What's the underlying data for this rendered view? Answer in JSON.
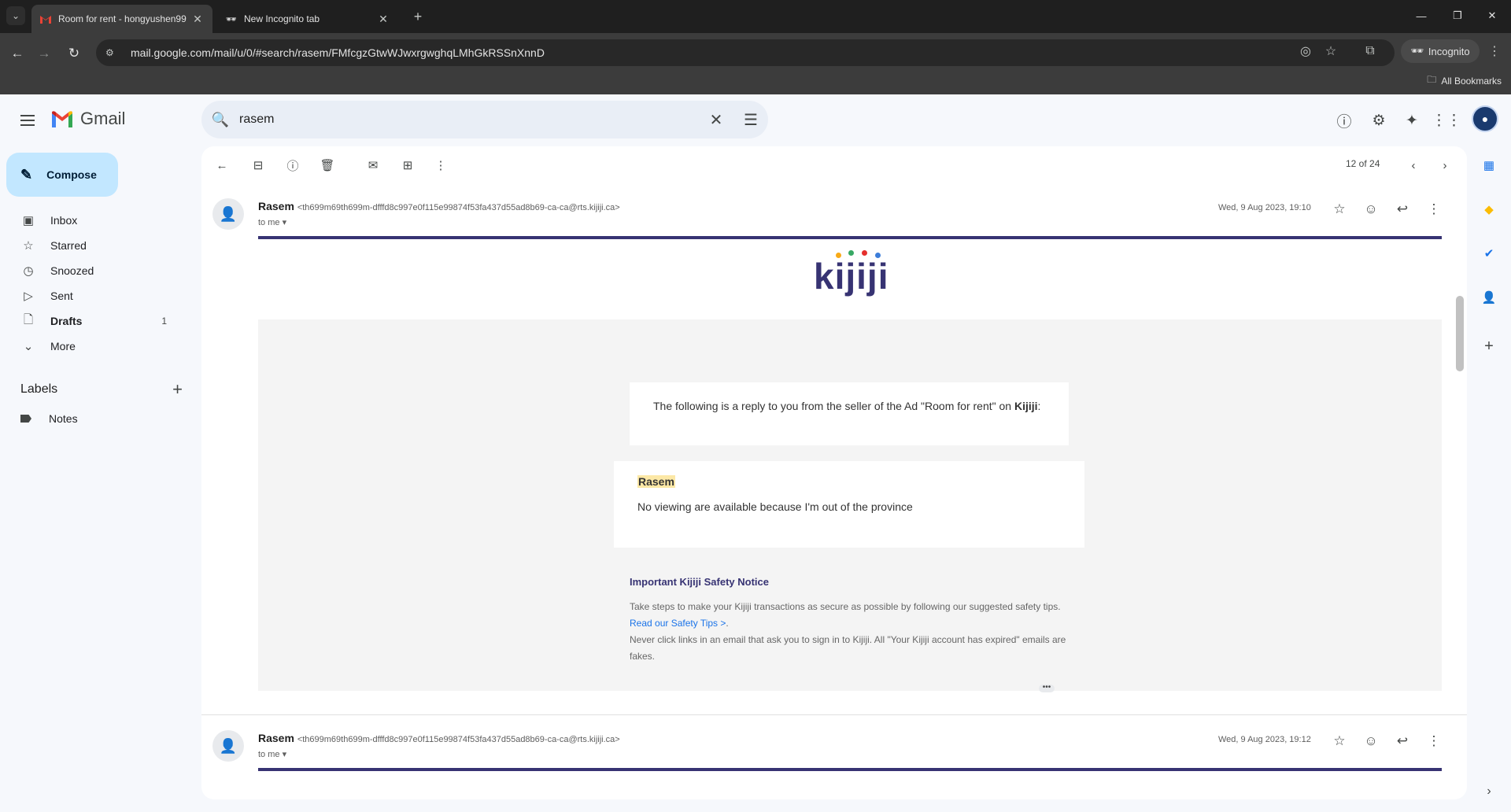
{
  "browser": {
    "tabs": [
      {
        "title": "Room for rent - hongyushen99",
        "active": true
      },
      {
        "title": "New Incognito tab",
        "active": false
      }
    ],
    "url": "mail.google.com/mail/u/0/#search/rasem/FMfcgzGtwWJwxrgwghqLMhGkRSSnXnnD",
    "incognito_label": "Incognito",
    "bookmarks_label": "All Bookmarks"
  },
  "gmail": {
    "brand": "Gmail",
    "search_value": "rasem",
    "compose_label": "Compose",
    "nav": [
      {
        "label": "Inbox",
        "count": "",
        "icon": "inbox-icon"
      },
      {
        "label": "Starred",
        "count": "",
        "icon": "star-icon"
      },
      {
        "label": "Snoozed",
        "count": "",
        "icon": "clock-icon"
      },
      {
        "label": "Sent",
        "count": "",
        "icon": "send-icon"
      },
      {
        "label": "Drafts",
        "count": "1",
        "icon": "draft-icon"
      },
      {
        "label": "More",
        "count": "",
        "icon": "chevron-down-icon"
      }
    ],
    "labels_title": "Labels",
    "labels": [
      {
        "label": "Notes"
      }
    ],
    "pager": "12 of 24"
  },
  "messages": [
    {
      "sender": "Rasem",
      "address": "<th699m69th699m-dfffd8c997e0f115e99874f53fa437d55ad8b69-ca-ca@rts.kijiji.ca>",
      "to": "to me",
      "date": "Wed, 9 Aug 2023, 19:10"
    },
    {
      "sender": "Rasem",
      "address": "<th699m69th699m-dfffd8c997e0f115e99874f53fa437d55ad8b69-ca-ca@rts.kijiji.ca>",
      "to": "to me",
      "date": "Wed, 9 Aug 2023, 19:12"
    }
  ],
  "email": {
    "logo_text": "kijiji",
    "intro": "The following is a reply to you from the seller of the Ad \"Room for rent\" on",
    "intro_brand": "Kijiji",
    "intro_end": ":",
    "reply_name": "Rasem",
    "reply_text": "No viewing are available because I'm out of the province",
    "safety_title": "Important Kijiji Safety Notice",
    "safety_p1": "Take steps to make your Kijiji transactions as secure as possible by following our suggested safety tips.",
    "safety_link": "Read our Safety Tips >",
    "safety_p1_end": ".",
    "safety_p2": "Never click links in an email that ask you to sign in to Kijiji. All \"Your Kijiji account has expired\" emails are fakes."
  },
  "colors": {
    "kijiji_purple": "#373373",
    "compose_bg": "#c2e7ff",
    "highlight": "#fce8a6"
  }
}
